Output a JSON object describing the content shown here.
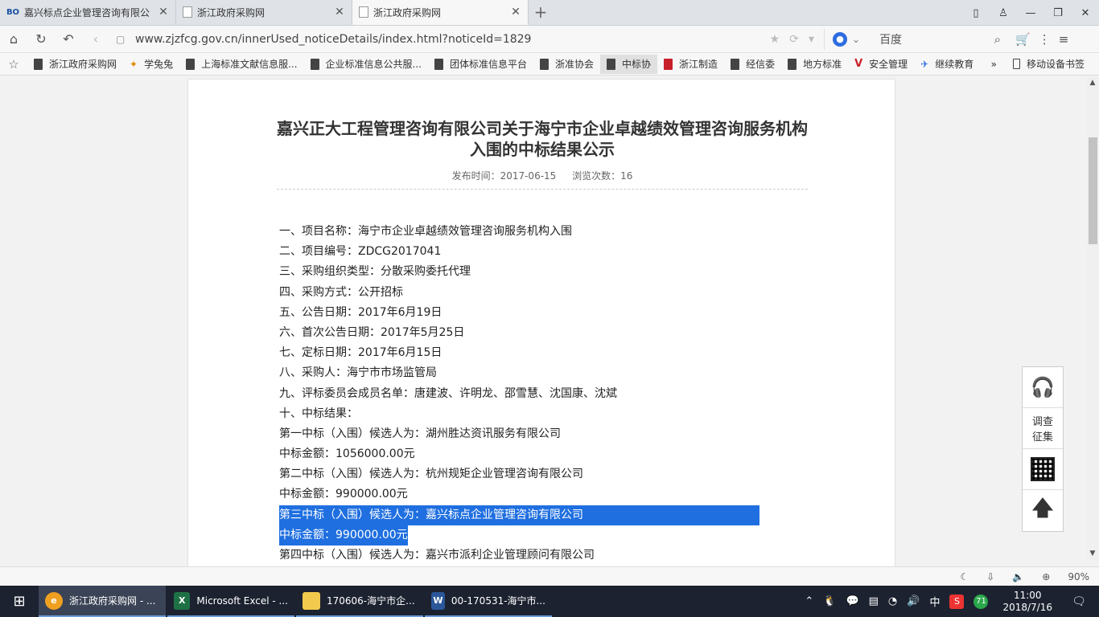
{
  "tabs": [
    {
      "title": "嘉兴标点企业管理咨询有限公",
      "icon": "bo-icon",
      "active": false
    },
    {
      "title": "浙江政府采购网",
      "icon": "doc-icon",
      "active": false
    },
    {
      "title": "浙江政府采购网",
      "icon": "doc-icon",
      "active": true
    }
  ],
  "address": {
    "url": "www.zjzfcg.gov.cn/innerUsed_noticeDetails/index.html?noticeId=1829",
    "search_engine": "百度"
  },
  "bookmarks": [
    "浙江政府采购网",
    "学兔兔",
    "上海标准文献信息服...",
    "企业标准信息公共服...",
    "团体标准信息平台",
    "浙准协会",
    "中标协",
    "浙江制造",
    "经信委",
    "地方标准",
    "安全管理",
    "继续教育"
  ],
  "bookmarks_more": "»",
  "mobile_bookmarks": "移动设备书签",
  "article": {
    "title": "嘉兴正大工程管理咨询有限公司关于海宁市企业卓越绩效管理咨询服务机构入围的中标结果公示",
    "publish_label": "发布时间：2017-06-15",
    "views_label": "浏览次数：16",
    "lines": [
      "一、项目名称：海宁市企业卓越绩效管理咨询服务机构入围",
      "二、项目编号：ZDCG2017041",
      "三、采购组织类型：分散采购委托代理",
      "四、采购方式：公开招标",
      "五、公告日期：2017年6月19日",
      "六、首次公告日期：2017年5月25日",
      "七、定标日期：2017年6月15日",
      "八、采购人：海宁市市场监管局",
      "九、评标委员会成员名单：唐建波、许明龙、邵雪慧、沈国康、沈斌",
      "十、中标结果：",
      "第一中标（入围）候选人为：湖州胜达资讯服务有限公司",
      "中标金额：1056000.00元",
      "第二中标（入围）候选人为：杭州规矩企业管理咨询有限公司",
      "中标金额：990000.00元",
      "第三中标（入围）候选人为：嘉兴标点企业管理咨询有限公司",
      "中标金额：990000.00元",
      "第四中标（入围）候选人为：嘉兴市派利企业管理顾问有限公司"
    ],
    "selected_line_indices": [
      14,
      15
    ]
  },
  "sidetools": {
    "survey_line1": "调查",
    "survey_line2": "征集"
  },
  "statusbar": {
    "zoom": "90%"
  },
  "taskbar": {
    "items": [
      {
        "label": "浙江政府采购网 - ...",
        "icon_text": "e",
        "kind": "browser",
        "active": true
      },
      {
        "label": "Microsoft Excel - ...",
        "icon_text": "X",
        "kind": "excel",
        "active": false
      },
      {
        "label": "170606-海宁市企...",
        "icon_text": "",
        "kind": "folder",
        "active": false
      },
      {
        "label": "00-170531-海宁市...",
        "icon_text": "W",
        "kind": "word",
        "active": false
      }
    ],
    "tray_badge": "71",
    "ime": "中",
    "sogou": "S",
    "time": "11:00",
    "date": "2018/7/16"
  }
}
